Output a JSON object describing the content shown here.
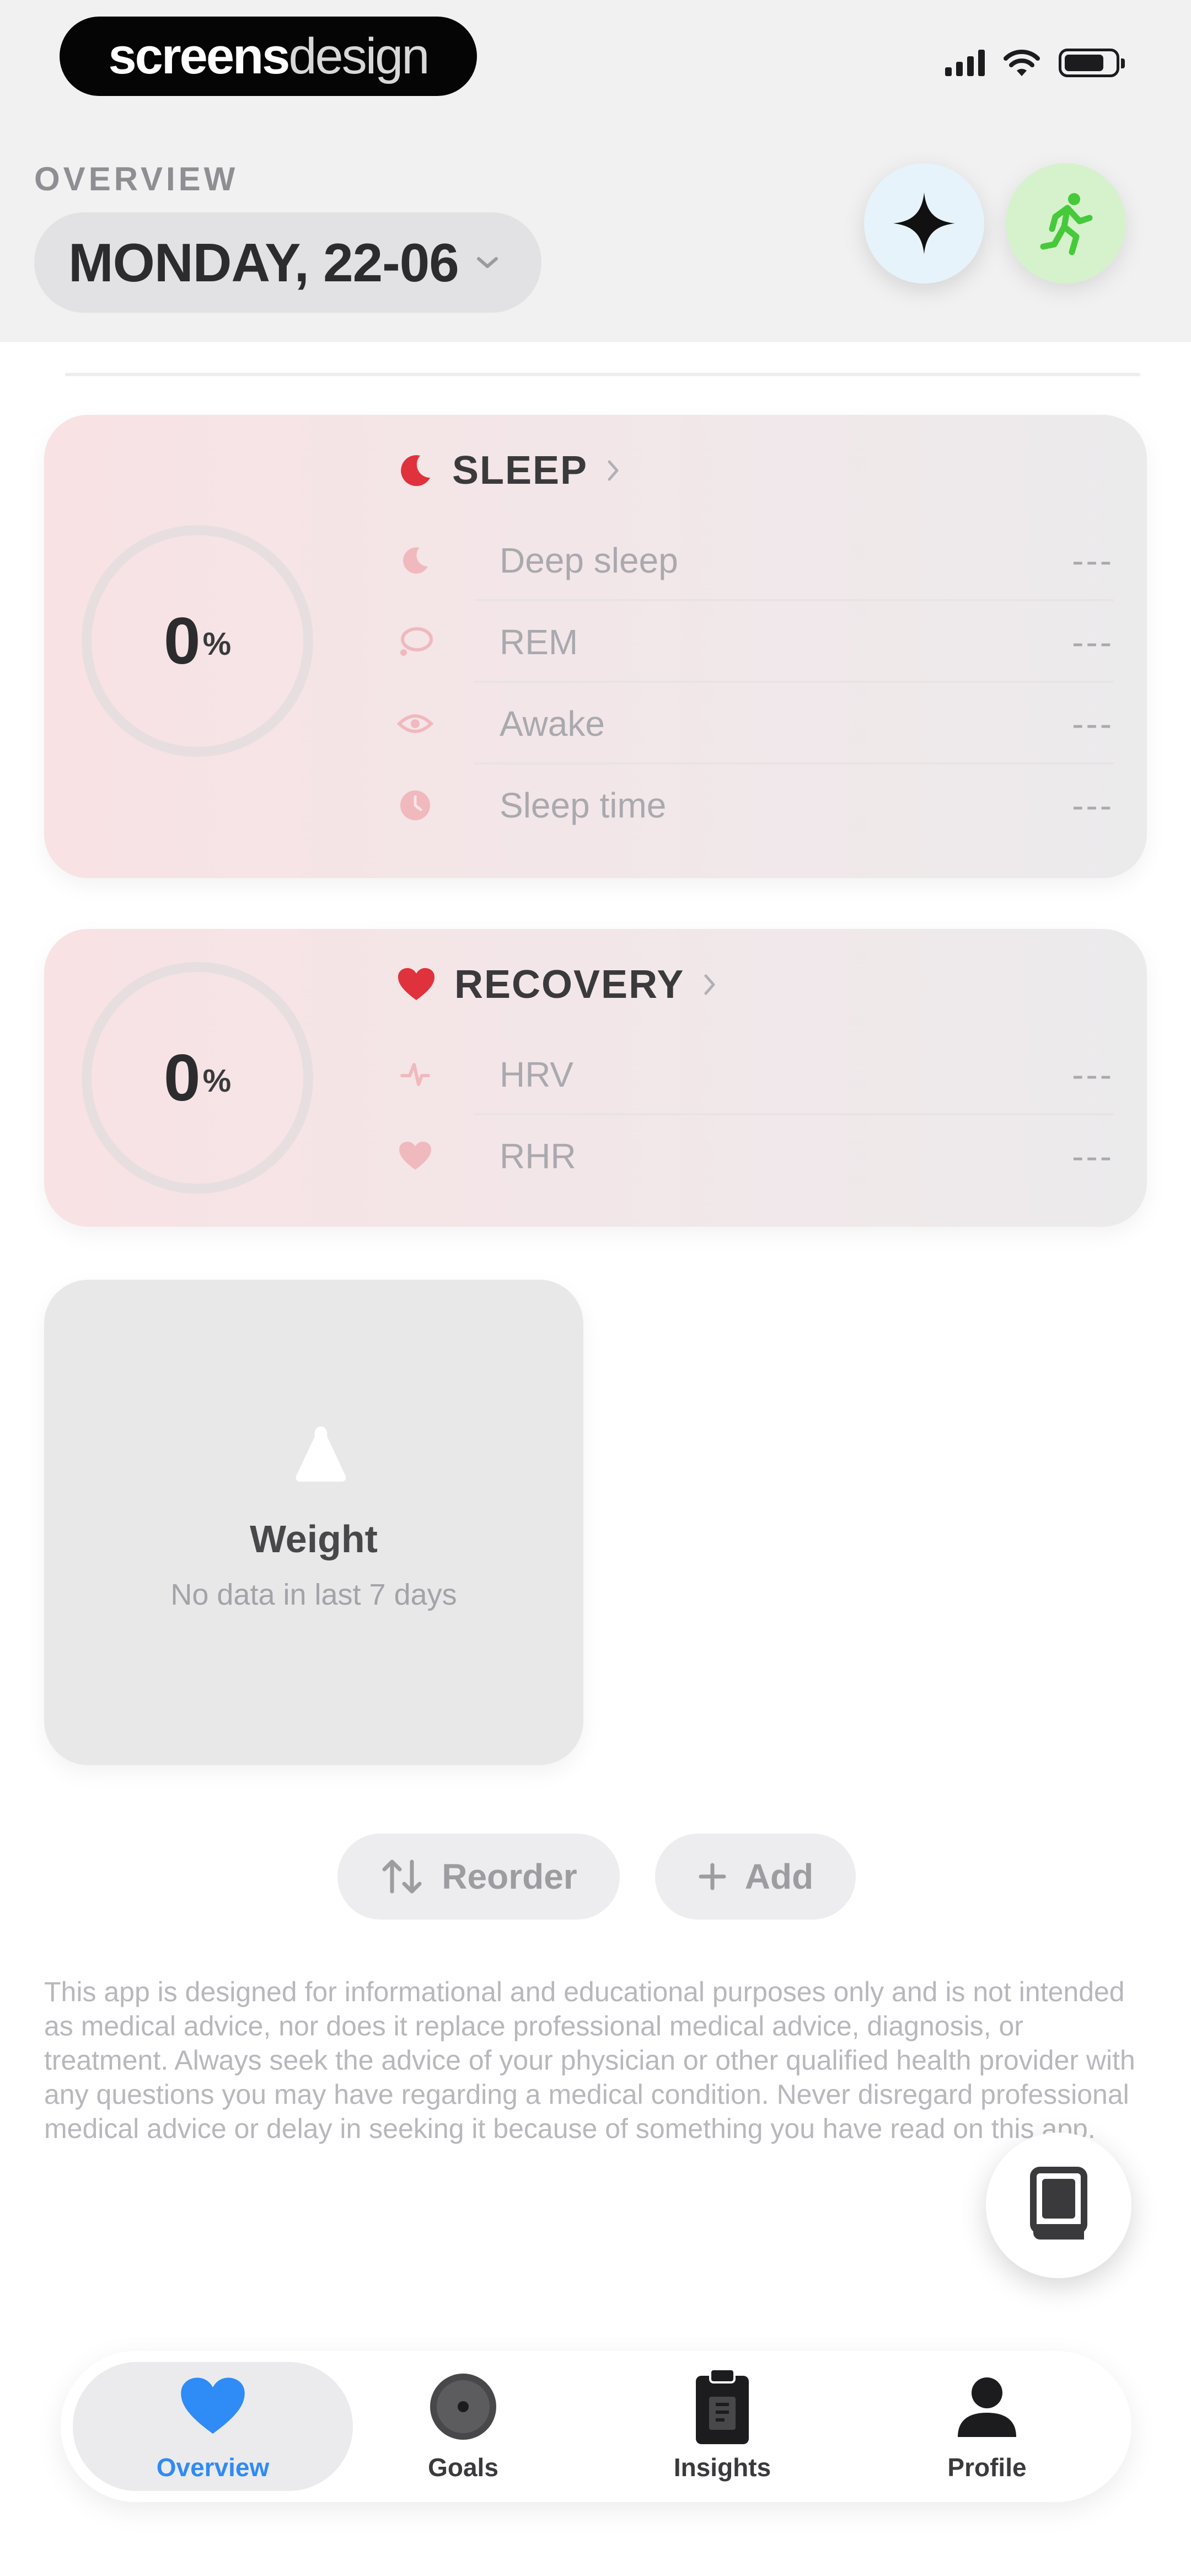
{
  "status_bar": {
    "brand_bold": "screens",
    "brand_light": "design",
    "signal_icon": "cellular-signal-icon",
    "wifi_icon": "wifi-icon",
    "battery_icon": "battery-icon"
  },
  "header": {
    "overview_label": "OVERVIEW",
    "date": "MONDAY, 22-06",
    "ai_button_icon": "sparkle-icon",
    "activity_button_icon": "running-figure-icon"
  },
  "sleep": {
    "title": "SLEEP",
    "score": "0",
    "unit": "%",
    "accent": "#e0323c",
    "metrics": [
      {
        "label": "Deep sleep",
        "value": "---",
        "icon": "moon-icon"
      },
      {
        "label": "REM",
        "value": "---",
        "icon": "thought-bubble-icon"
      },
      {
        "label": "Awake",
        "value": "---",
        "icon": "eye-icon"
      },
      {
        "label": "Sleep time",
        "value": "---",
        "icon": "clock-icon"
      }
    ]
  },
  "recovery": {
    "title": "RECOVERY",
    "score": "0",
    "unit": "%",
    "accent": "#e0323c",
    "metrics": [
      {
        "label": "HRV",
        "value": "---",
        "icon": "pulse-icon"
      },
      {
        "label": "RHR",
        "value": "---",
        "icon": "heart-pulse-icon"
      }
    ]
  },
  "weight": {
    "title": "Weight",
    "subtitle": "No data in last 7 days",
    "icon": "scale-icon"
  },
  "actions": {
    "reorder_label": "Reorder",
    "add_label": "Add"
  },
  "disclaimer": "This app is designed for informational and educational purposes only and is not intended as medical advice, nor does it replace professional medical advice, diagnosis, or treatment. Always seek the advice of your physician or other qualified health provider with any questions you may have regarding a medical condition. Never disregard professional medical advice or delay in seeking it because of something you have read on this app.",
  "guide_fab_icon": "book-icon",
  "tabbar": {
    "active_color": "#2f8bf5",
    "tabs": [
      {
        "label": "Overview",
        "icon": "heart-icon",
        "active": true
      },
      {
        "label": "Goals",
        "icon": "target-icon",
        "active": false
      },
      {
        "label": "Insights",
        "icon": "clipboard-icon",
        "active": false
      },
      {
        "label": "Profile",
        "icon": "person-icon",
        "active": false
      }
    ]
  }
}
